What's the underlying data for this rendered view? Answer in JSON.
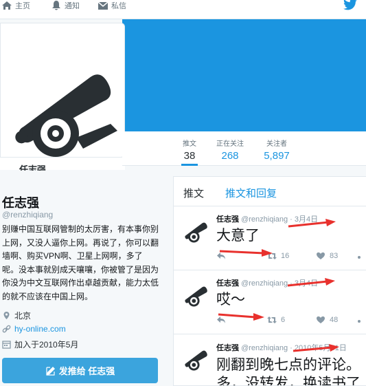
{
  "nav": {
    "home": "主页",
    "notifications": "通知",
    "messages": "私信"
  },
  "profile": {
    "cut_name": "任志强",
    "name": "任志强",
    "handle": "@renzhiqiang",
    "bio": "别赚中国互联网管制的太厉害，有本事你别上网，又没人逼你上网。再说了，你可以翻墙啊、购买VPN啊、卫星上网啊，多了呢。没本事就别成天嚷嚷，你被管了是因为你没为中文互联网作出卓越贡献，能力太低的就不应该在中国上网。",
    "location": "北京",
    "website": "hy-online.com",
    "joined": "加入于2010年5月",
    "tweet_to": "发推给 任志强"
  },
  "stats": [
    {
      "label": "推文",
      "value": "38"
    },
    {
      "label": "正在关注",
      "value": "268"
    },
    {
      "label": "关注者",
      "value": "5,897"
    }
  ],
  "timeline": {
    "tab1": "推文",
    "tab2": "推文和回复",
    "tweets": [
      {
        "name": "任志强",
        "handle": "@renzhiqiang",
        "date": "· 3月4日",
        "text": "大意了",
        "retweets": "16",
        "likes": "83"
      },
      {
        "name": "任志强",
        "handle": "@renzhiqiang",
        "date": "· 3月4日",
        "text": "哎～",
        "retweets": "6",
        "likes": "48"
      },
      {
        "name": "任志强",
        "handle": "@renzhiqiang",
        "date": "· 2010年5月31日",
        "text": "刚翻到晚七点的评论。",
        "text2": "多，没转发，换读书了"
      }
    ]
  },
  "colors": {
    "accent": "#1b95e0",
    "button": "#3ba4dd",
    "arrow": "#e8312d"
  },
  "icons": [
    "home-icon",
    "bell-icon",
    "envelope-icon",
    "twitter-bird-icon",
    "cannon-icon",
    "location-pin-icon",
    "link-icon",
    "calendar-icon",
    "compose-icon",
    "reply-icon",
    "retweet-icon",
    "heart-icon"
  ]
}
